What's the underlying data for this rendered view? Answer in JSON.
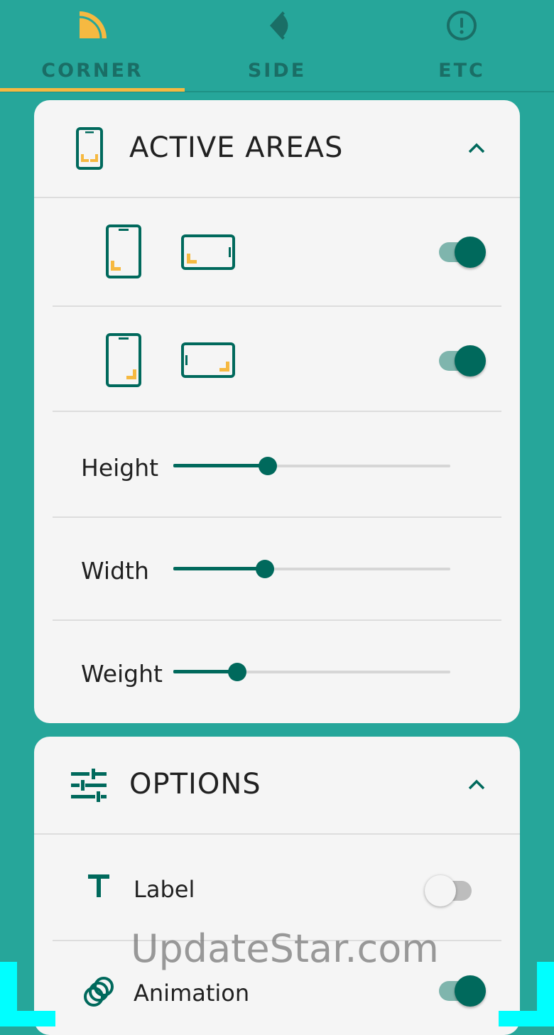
{
  "tabs": [
    {
      "label": "CORNER",
      "icon": "quarter-circle-icon",
      "selected": true
    },
    {
      "label": "SIDE",
      "icon": "half-lens-icon",
      "selected": false
    },
    {
      "label": "ETC",
      "icon": "alert-circle-icon",
      "selected": false
    }
  ],
  "colors": {
    "background": "#26a69a",
    "accent": "#00695c",
    "highlight": "#f6b941",
    "card": "#f5f5f5"
  },
  "active_areas": {
    "title": "ACTIVE AREAS",
    "icon": "phone-corners-icon",
    "rows": [
      {
        "icons": [
          "phone-portrait-bottom-left-icon",
          "phone-landscape-bottom-left-icon"
        ],
        "enabled": true
      },
      {
        "icons": [
          "phone-portrait-bottom-right-icon",
          "phone-landscape-bottom-right-icon"
        ],
        "enabled": true
      }
    ],
    "sliders": [
      {
        "label": "Height",
        "value": 0.34
      },
      {
        "label": "Width",
        "value": 0.33
      },
      {
        "label": "Weight",
        "value": 0.23
      }
    ]
  },
  "options": {
    "title": "OPTIONS",
    "icon": "tune-icon",
    "items": [
      {
        "label": "Label",
        "icon": "text-icon",
        "enabled": false
      },
      {
        "label": "Animation",
        "icon": "rings-icon",
        "enabled": true
      }
    ]
  },
  "watermark": "UpdateStar.com"
}
